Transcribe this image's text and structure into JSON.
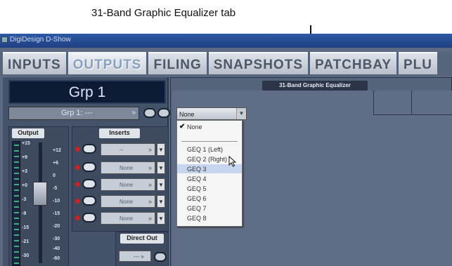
{
  "callout": {
    "label": "31-Band Graphic Equalizer tab"
  },
  "window": {
    "title": "DigiDesign D-Show"
  },
  "tabs": [
    {
      "label": "INPUTS"
    },
    {
      "label": "OUTPUTS"
    },
    {
      "label": "FILING"
    },
    {
      "label": "SNAPSHOTS"
    },
    {
      "label": "PATCHBAY"
    },
    {
      "label": "PLU"
    }
  ],
  "channel": {
    "name": "Grp 1",
    "selector": "Grp 1: ---"
  },
  "output": {
    "label": "Output",
    "scale_left": [
      "+15",
      "+9",
      "+3",
      "+0",
      "-3",
      "-9",
      "-15",
      "-21",
      "-30"
    ],
    "scale_right": [
      "+12",
      "+6",
      "0",
      "-5",
      "-10",
      "-15",
      "-20",
      "-30",
      "-40",
      "-60"
    ]
  },
  "inserts": {
    "label": "Inserts",
    "slots": [
      "--",
      "None",
      "None",
      "None",
      "None"
    ]
  },
  "direct_out": {
    "label": "Direct Out",
    "value": "---"
  },
  "geq": {
    "header": "31-Band Graphic Equalizer",
    "selected": "None",
    "options": [
      "None",
      "GEQ 1 (Left)",
      "GEQ 2 (Right)",
      "GEQ 3",
      "GEQ 4",
      "GEQ 5",
      "GEQ 6",
      "GEQ 7",
      "GEQ 8"
    ],
    "highlighted": "GEQ 3"
  },
  "colors": {
    "accent": "#2d5aa7",
    "panel": "#5b6a82",
    "highlight": "#c7d6ee"
  }
}
